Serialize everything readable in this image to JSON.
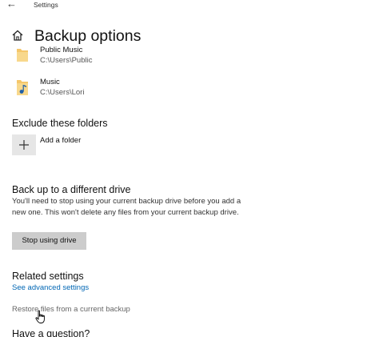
{
  "window": {
    "back_glyph": "←",
    "app_title": "Settings"
  },
  "header": {
    "title": "Backup options",
    "icon": "home-icon"
  },
  "folders": [
    {
      "name": "Public Music",
      "path": "C:\\Users\\Public",
      "icon": "folder-icon"
    },
    {
      "name": "Music",
      "path": "C:\\Users\\Lori",
      "icon": "music-folder-icon"
    }
  ],
  "exclude": {
    "heading": "Exclude these folders",
    "add_label": "Add a folder",
    "add_icon": "plus-icon"
  },
  "different_drive": {
    "heading": "Back up to a different drive",
    "description": "You'll need to stop using your current backup drive before you add a new one. This won't delete any files from your current backup drive.",
    "stop_button": "Stop using drive"
  },
  "related": {
    "heading": "Related settings",
    "advanced_link": "See advanced settings",
    "restore_link": "Restore files from a current backup"
  },
  "question": {
    "heading": "Have a question?"
  },
  "colors": {
    "link": "#0066b4",
    "button_bg": "#cccccc",
    "folder": "#f5c76a"
  }
}
